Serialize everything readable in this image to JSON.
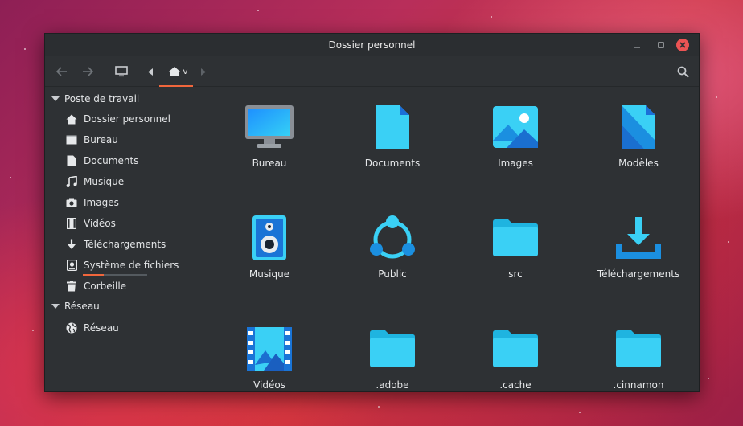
{
  "window": {
    "title": "Dossier personnel"
  },
  "toolbar": {
    "home_label": "v"
  },
  "sidebar": {
    "sections": [
      {
        "label": "Poste de travail"
      },
      {
        "label": "Réseau"
      }
    ],
    "items": [
      {
        "label": "Dossier personnel",
        "icon": "home-icon"
      },
      {
        "label": "Bureau",
        "icon": "desktop-icon"
      },
      {
        "label": "Documents",
        "icon": "document-icon"
      },
      {
        "label": "Musique",
        "icon": "music-note-icon"
      },
      {
        "label": "Images",
        "icon": "camera-icon"
      },
      {
        "label": "Vidéos",
        "icon": "film-icon"
      },
      {
        "label": "Téléchargements",
        "icon": "download-arrow-icon"
      },
      {
        "label": "Système de fichiers",
        "icon": "drive-icon",
        "usage": 0.32
      },
      {
        "label": "Corbeille",
        "icon": "trash-icon"
      },
      {
        "label": "Réseau",
        "icon": "globe-icon"
      }
    ]
  },
  "files": [
    {
      "label": "Bureau",
      "icon": "monitor-icon"
    },
    {
      "label": "Documents",
      "icon": "document-file-icon"
    },
    {
      "label": "Images",
      "icon": "image-picture-icon"
    },
    {
      "label": "Modèles",
      "icon": "template-file-icon"
    },
    {
      "label": "Musique",
      "icon": "speaker-icon"
    },
    {
      "label": "Public",
      "icon": "share-icon"
    },
    {
      "label": "src",
      "icon": "folder-icon"
    },
    {
      "label": "Téléchargements",
      "icon": "download-tray-icon"
    },
    {
      "label": "Vidéos",
      "icon": "video-film-icon"
    },
    {
      "label": ".adobe",
      "icon": "folder-icon"
    },
    {
      "label": ".cache",
      "icon": "folder-icon"
    },
    {
      "label": ".cinnamon",
      "icon": "folder-icon"
    }
  ],
  "colors": {
    "accent": "#f0663c",
    "icon_blue": "#3ad0f5",
    "window_bg": "#2e3134",
    "close": "#ec5454"
  }
}
